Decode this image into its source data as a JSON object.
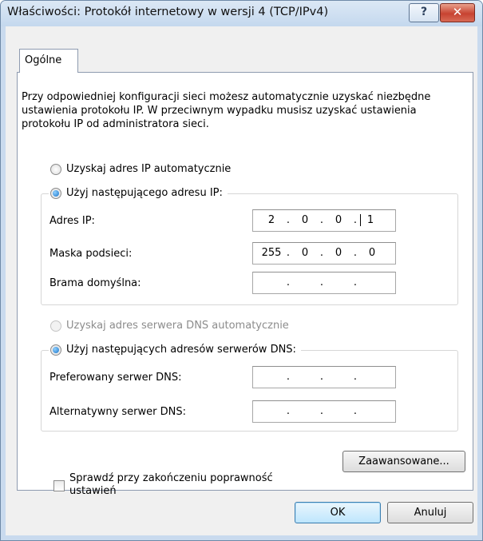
{
  "window": {
    "title": "Właściwości: Protokół internetowy w wersji 4 (TCP/IPv4)",
    "help_label": "?",
    "close_label": "✕"
  },
  "tabs": [
    {
      "label": "Ogólne",
      "active": true
    }
  ],
  "intro_text": "Przy odpowiedniej konfiguracji sieci możesz automatycznie uzyskać niezbędne ustawienia protokołu IP. W przeciwnym wypadku musisz uzyskać ustawienia protokołu IP od administratora sieci.",
  "ip_section": {
    "auto_label": "Uzyskaj adres IP automatycznie",
    "manual_label": "Użyj następującego adresu IP:",
    "selected": "manual",
    "fields": [
      {
        "label": "Adres IP:",
        "octets": [
          "2",
          "0",
          "0",
          "1"
        ]
      },
      {
        "label": "Maska podsieci:",
        "octets": [
          "255",
          "0",
          "0",
          "0"
        ]
      },
      {
        "label": "Brama domyślna:",
        "octets": [
          "",
          "",
          "",
          ""
        ]
      }
    ]
  },
  "dns_section": {
    "auto_label": "Uzyskaj adres serwera DNS automatycznie",
    "manual_label": "Użyj następujących adresów serwerów DNS:",
    "selected": "manual",
    "fields": [
      {
        "label": "Preferowany serwer DNS:",
        "octets": [
          "",
          "",
          "",
          ""
        ]
      },
      {
        "label": "Alternatywny serwer DNS:",
        "octets": [
          "",
          "",
          "",
          ""
        ]
      }
    ]
  },
  "validate_checkbox": {
    "label": "Sprawdź przy zakończeniu poprawność ustawień",
    "checked": false
  },
  "buttons": {
    "advanced": "Zaawansowane...",
    "ok": "OK",
    "cancel": "Anuluj"
  },
  "colors": {
    "title_bar": "#c4d8ee",
    "close_button": "#c74331",
    "radio_selected": "#1b74c8"
  }
}
